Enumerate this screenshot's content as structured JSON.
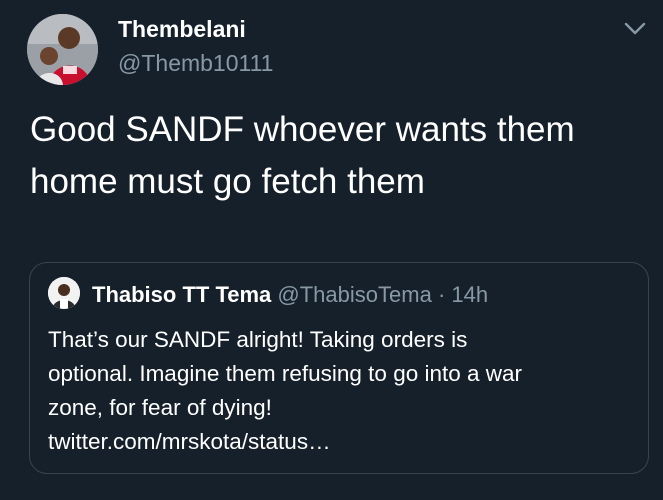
{
  "tweet": {
    "author": {
      "display_name": "Thembelani",
      "handle": "@Themb10111",
      "avatar_icon": "user-avatar-photo"
    },
    "menu_icon": "chevron-down-icon",
    "text_line1": "Good SANDF whoever wants them",
    "text_line2": "home must go fetch them"
  },
  "quoted_tweet": {
    "author": {
      "display_name": "Thabiso TT Tema",
      "handle": "@ThabisoTema",
      "separator": "·",
      "time": "14h",
      "avatar_icon": "user-avatar-photo"
    },
    "line1": "That’s our SANDF alright! Taking orders is",
    "line2": "optional. Imagine them refusing to go into a war",
    "line3": "zone, for fear of dying!",
    "link": "twitter.com/mrskota/status…"
  },
  "colors": {
    "background": "#15202b",
    "primary_text": "#ffffff",
    "secondary_text": "#8899a6",
    "border": "#38444d"
  }
}
